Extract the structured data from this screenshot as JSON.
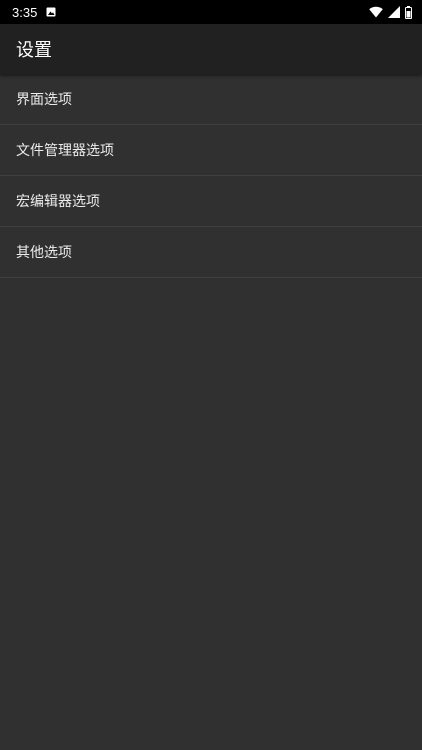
{
  "status_bar": {
    "time": "3:35",
    "icons": [
      "notification-icon",
      "wifi-icon",
      "signal-icon",
      "battery-icon"
    ]
  },
  "app_bar": {
    "title": "设置"
  },
  "settings": {
    "items": [
      {
        "label": "界面选项"
      },
      {
        "label": "文件管理器选项"
      },
      {
        "label": "宏编辑器选项"
      },
      {
        "label": "其他选项"
      }
    ]
  },
  "colors": {
    "status_bar_bg": "#000000",
    "app_bar_bg": "#212121",
    "background": "#303030",
    "divider": "#3f3f3f",
    "text_primary": "#ffffff"
  }
}
